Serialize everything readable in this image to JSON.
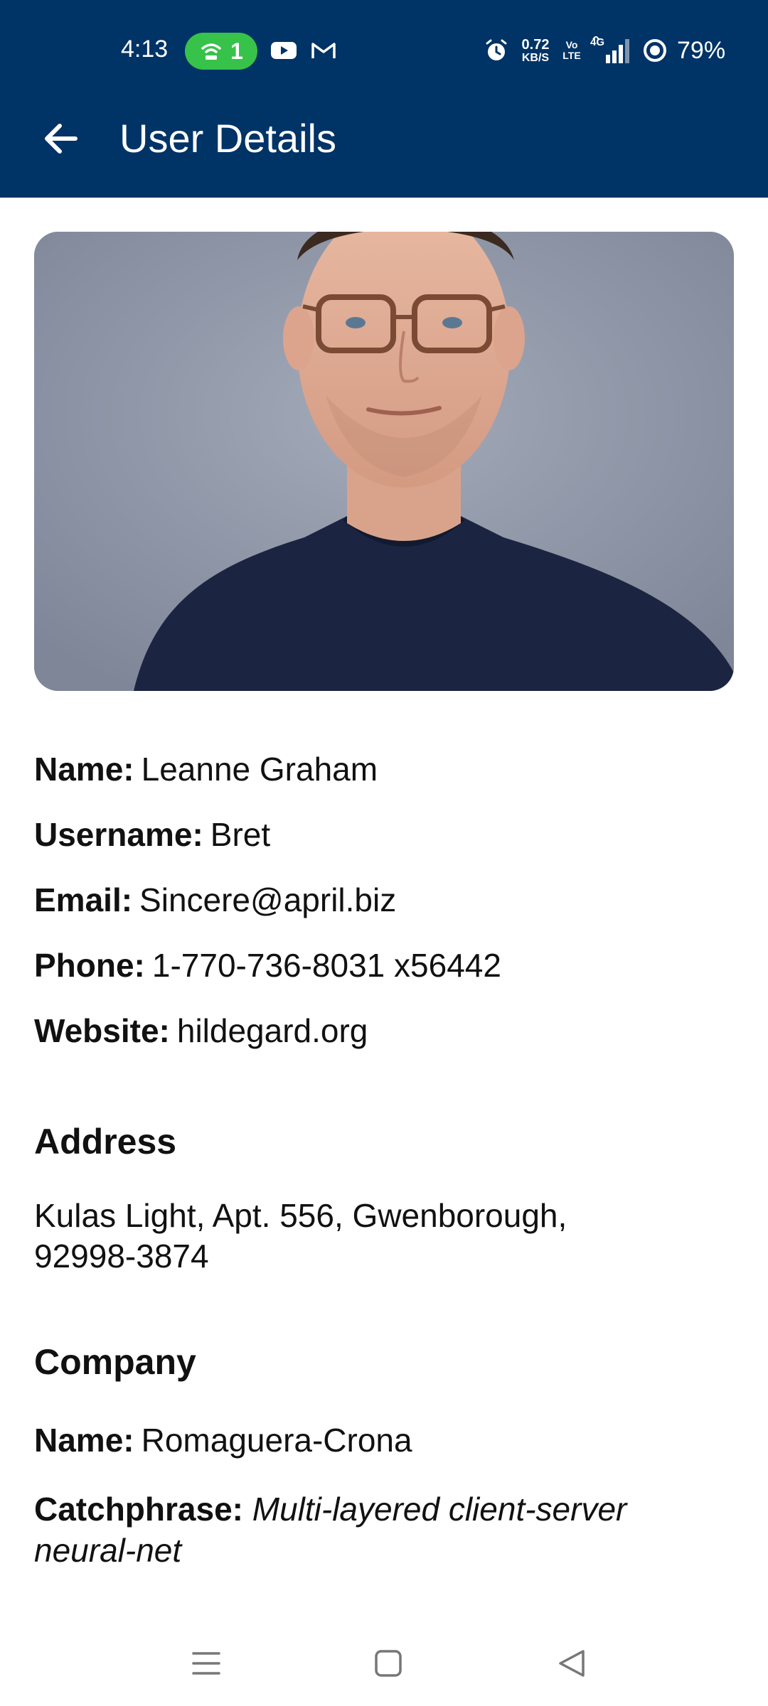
{
  "status_bar": {
    "time": "4:13",
    "hotspot_count": "1",
    "network_speed_value": "0.72",
    "network_speed_unit": "KB/S",
    "volte_top": "Vo",
    "volte_bottom": "LTE",
    "network_type": "4G",
    "battery": "79%"
  },
  "app_bar": {
    "title": "User Details",
    "back_icon": "arrow-left-icon"
  },
  "user": {
    "name_label": "Name:",
    "name": "Leanne Graham",
    "username_label": "Username:",
    "username": "Bret",
    "email_label": "Email:",
    "email": "Sincere@april.biz",
    "phone_label": "Phone:",
    "phone": "1-770-736-8031 x56442",
    "website_label": "Website:",
    "website": "hildegard.org"
  },
  "address": {
    "heading": "Address",
    "text": "Kulas Light, Apt. 556, Gwenborough, 92998-3874"
  },
  "company": {
    "heading": "Company",
    "name_label": "Name:",
    "name": "Romaguera-Crona",
    "catchphrase_label": "Catchphrase:",
    "catchphrase": "Multi-layered client-server neural-net"
  },
  "colors": {
    "app_bar": "#003366",
    "hotspot": "#37c24a",
    "text": "#111111"
  },
  "nav_icons": [
    "menu-icon",
    "home-icon",
    "back-triangle-icon"
  ]
}
